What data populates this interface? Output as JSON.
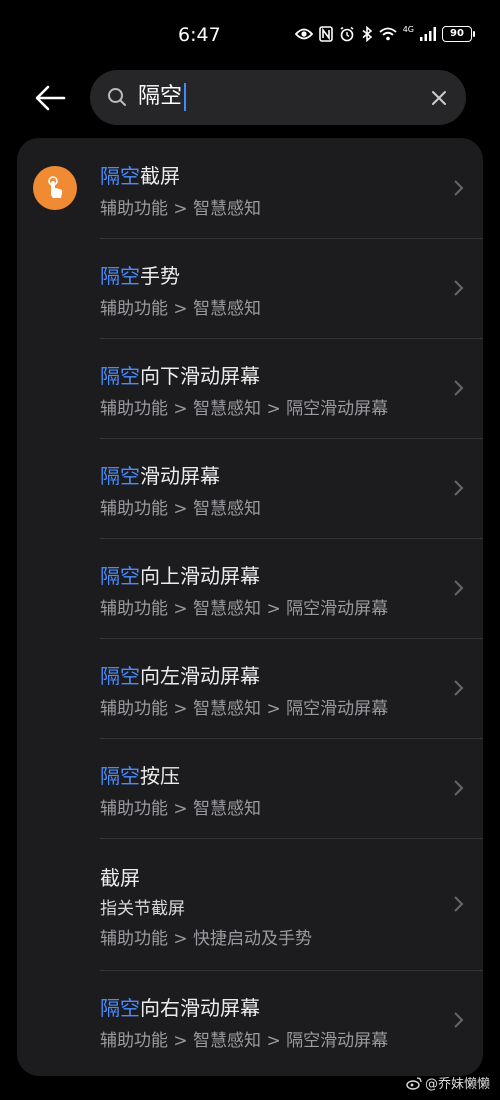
{
  "status_bar": {
    "time": "6:47",
    "network": "4G",
    "battery": "90"
  },
  "search": {
    "query": "隔空"
  },
  "results": [
    {
      "highlight": "隔空",
      "title_rest": "截屏",
      "path": "辅助功能 > 智慧感知",
      "has_icon": true
    },
    {
      "highlight": "隔空",
      "title_rest": "手势",
      "path": "辅助功能 > 智慧感知"
    },
    {
      "highlight": "隔空",
      "title_rest": "向下滑动屏幕",
      "path": "辅助功能 > 智慧感知 > 隔空滑动屏幕"
    },
    {
      "highlight": "隔空",
      "title_rest": "滑动屏幕",
      "path": "辅助功能 > 智慧感知"
    },
    {
      "highlight": "隔空",
      "title_rest": "向上滑动屏幕",
      "path": "辅助功能 > 智慧感知 > 隔空滑动屏幕"
    },
    {
      "highlight": "隔空",
      "title_rest": "向左滑动屏幕",
      "path": "辅助功能 > 智慧感知 > 隔空滑动屏幕"
    },
    {
      "highlight": "隔空",
      "title_rest": "按压",
      "path": "辅助功能 > 智慧感知"
    },
    {
      "highlight": "",
      "title_rest": "截屏",
      "desc": "指关节截屏",
      "path": "辅助功能 > 快捷启动及手势"
    },
    {
      "highlight": "隔空",
      "title_rest": "向右滑动屏幕",
      "path": "辅助功能 > 智慧感知 > 隔空滑动屏幕"
    }
  ],
  "watermark": "@乔妹懒懒",
  "colors": {
    "highlight": "#4a8cff",
    "icon_bg": "#f08a33",
    "card_bg": "#1c1c1e"
  },
  "icons": {
    "back": "arrow-left-icon",
    "search": "magnifier-icon",
    "clear": "close-icon",
    "chevron": "chevron-right-icon",
    "item": "hand-tap-icon"
  }
}
